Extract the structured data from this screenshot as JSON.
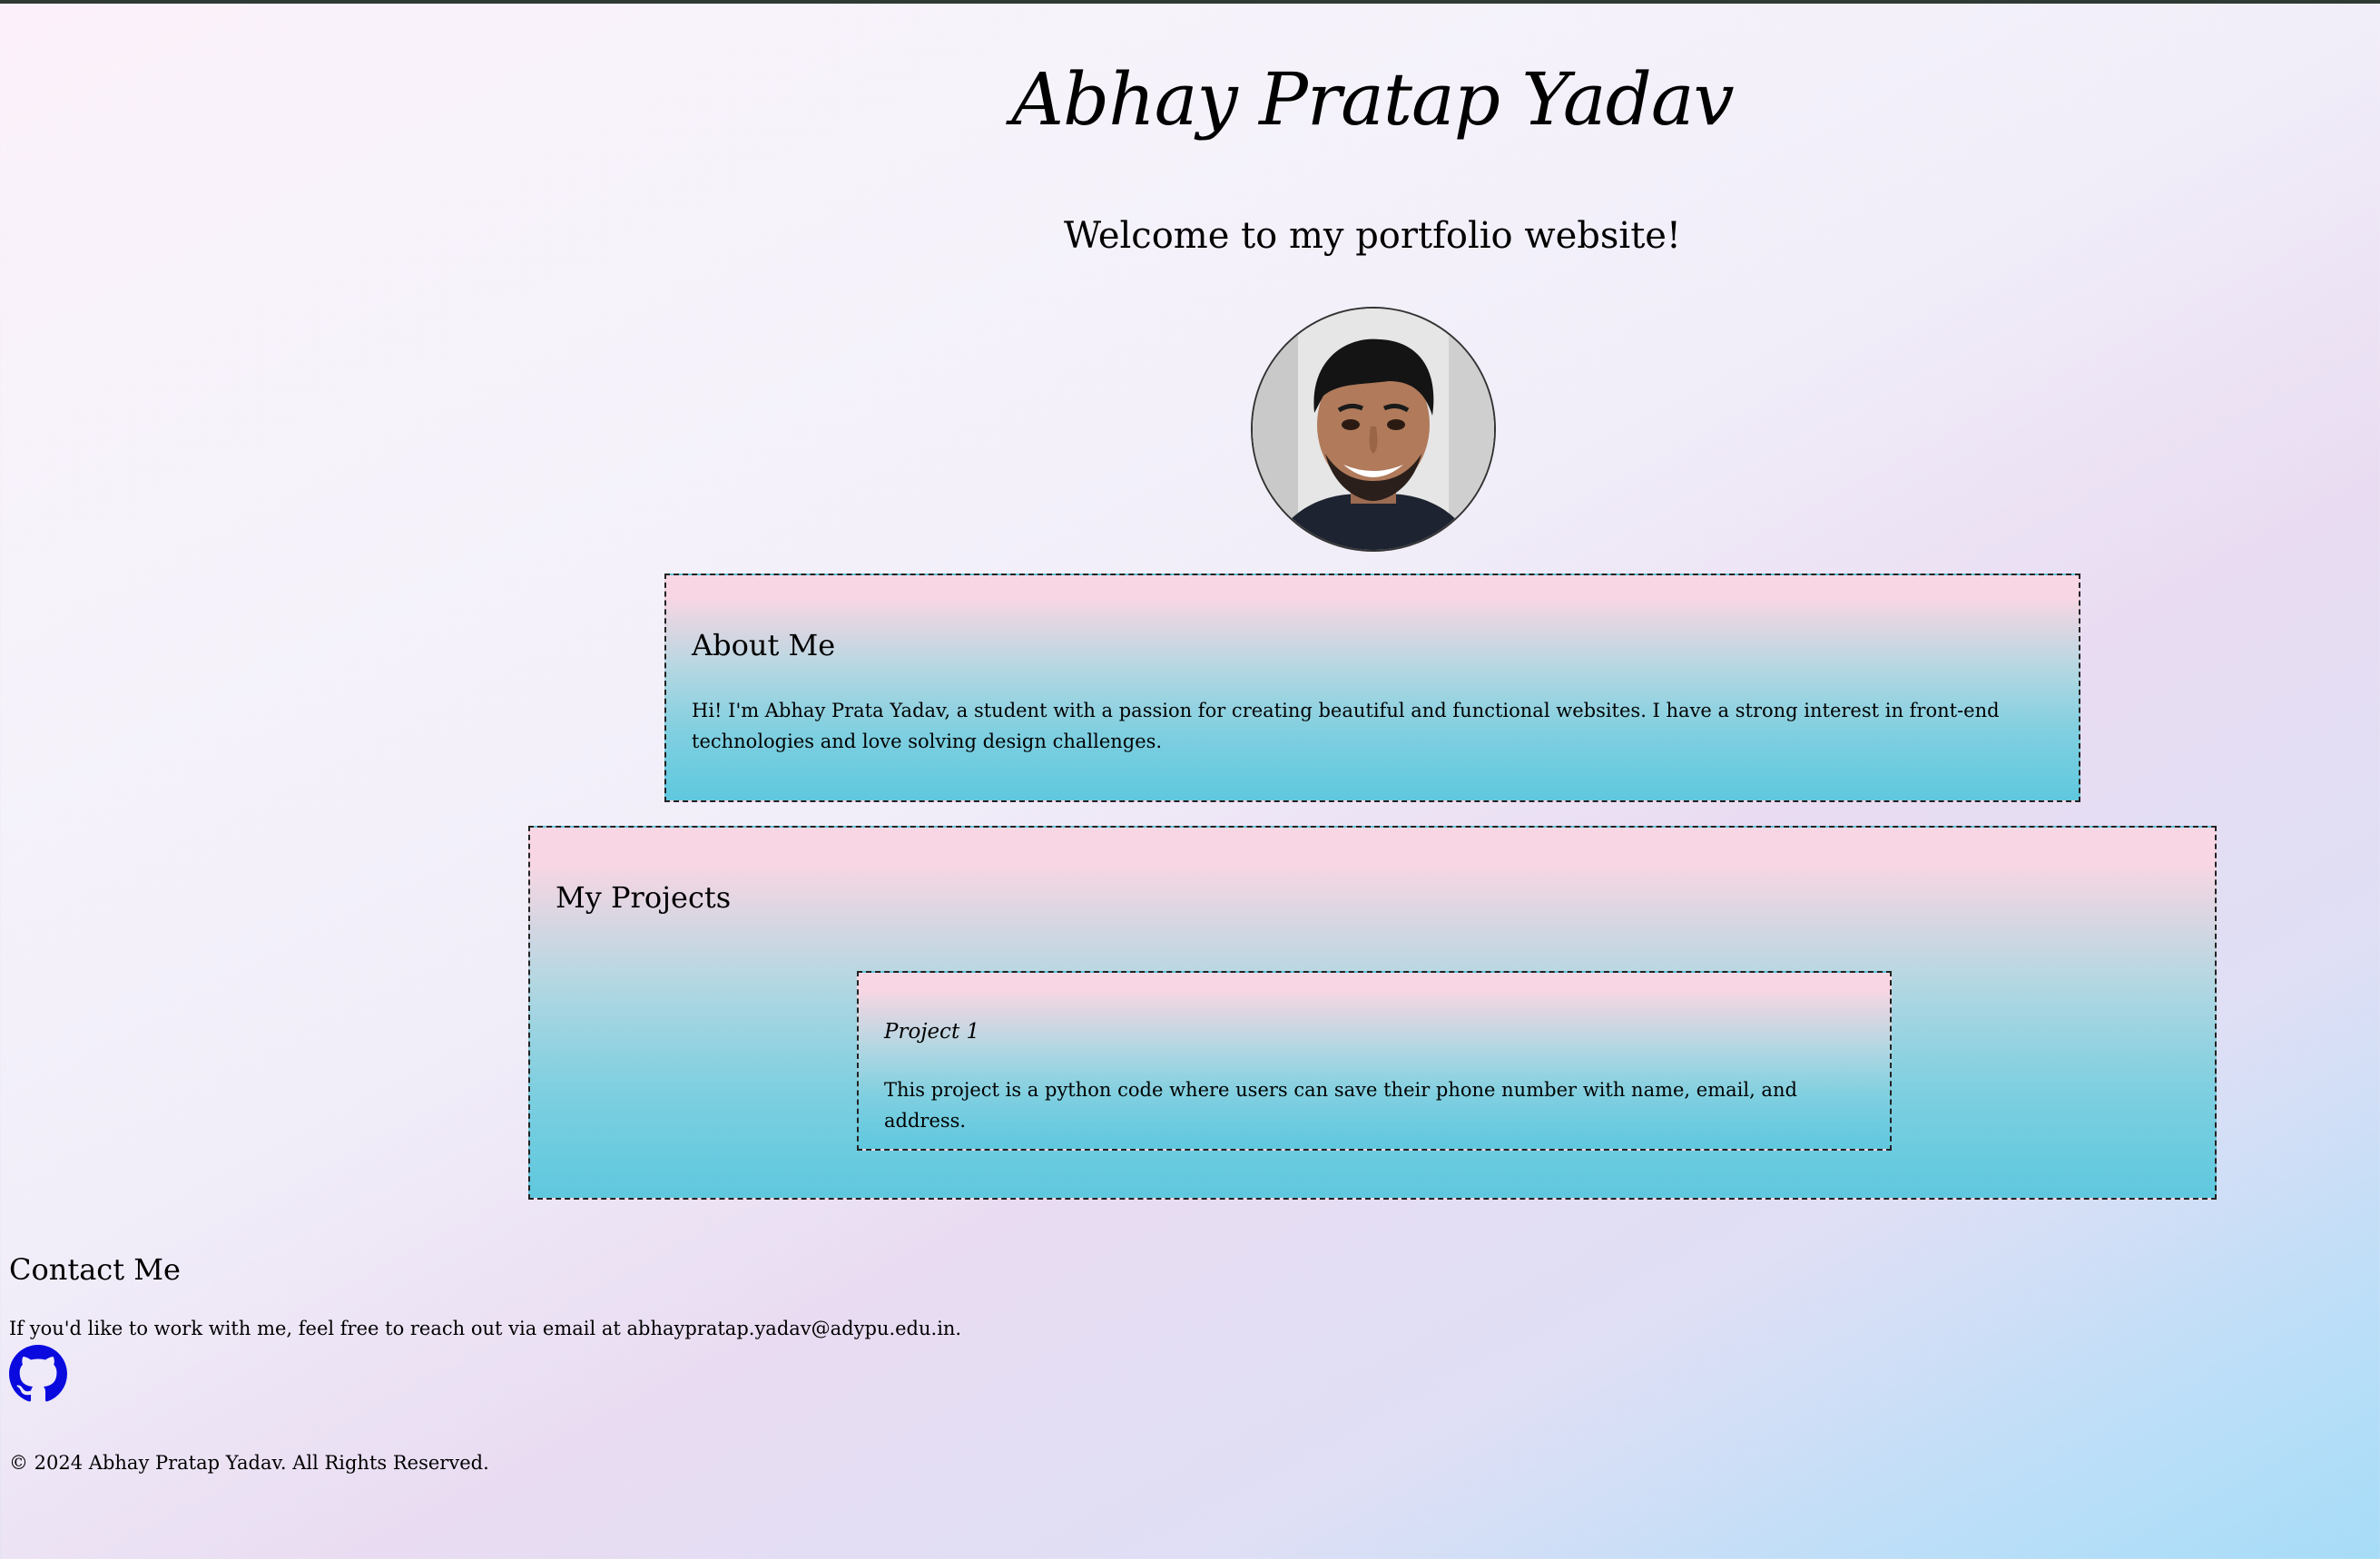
{
  "header": {
    "title": "Abhay Pratap Yadav",
    "welcome": "Welcome to my portfolio website!"
  },
  "about": {
    "heading": "About Me",
    "text": "Hi! I'm Abhay Prata Yadav, a student with a passion for creating beautiful and functional websites. I have a strong interest in front-end technologies and love solving design challenges."
  },
  "projects": {
    "heading": "My Projects",
    "items": [
      {
        "title": "Project 1",
        "description": "This project is a python code where users can save their phone number with name, email, and address."
      }
    ]
  },
  "contact": {
    "heading": "Contact Me",
    "text": "If you'd like to work with me, feel free to reach out via email at abhaypratap.yadav@adypu.edu.in.",
    "github_icon": "github-icon",
    "icon_color": "#0a0adf"
  },
  "footer": {
    "text": "© 2024 Abhay Pratap Yadav. All Rights Reserved."
  }
}
